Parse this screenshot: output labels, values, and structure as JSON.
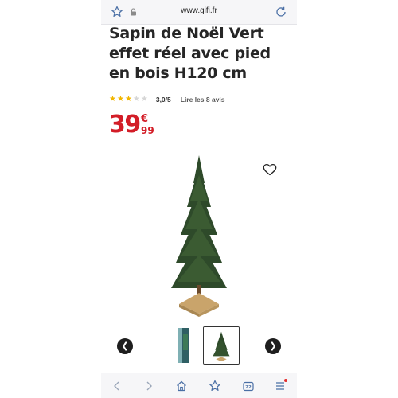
{
  "browser": {
    "url": "www.gifi.fr",
    "tabs_count": "22"
  },
  "product": {
    "title": "Sapin de Noël Vert effet réel avec pied en bois H120 cm",
    "rating_value": "3,0/5",
    "rating_stars": 3,
    "rating_max": 5,
    "reviews_link": "Lire les 8 avis",
    "price_int": "39",
    "price_currency": "€",
    "price_cents": "99"
  },
  "colors": {
    "price": "#d31d27",
    "star_filled": "#f2b600",
    "star_empty": "#d6d6d6",
    "browser_icons": "#4a6fa5"
  },
  "icons": {
    "favorite": "heart-icon",
    "prev": "chevron-left-icon",
    "next": "chevron-right-icon"
  }
}
